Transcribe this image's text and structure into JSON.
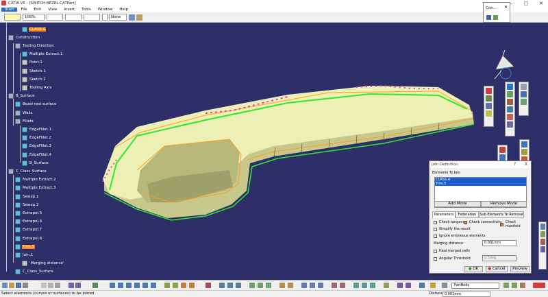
{
  "window": {
    "title": "CATIA V5 - [SWITCH BEZEL.CATPart]"
  },
  "menu": [
    "Start",
    "File",
    "Edit",
    "View",
    "Insert",
    "Tools",
    "Window",
    "Help"
  ],
  "toolbar": {
    "zoom": "100%",
    "layer": "None"
  },
  "con_dialog": {
    "title": "Con..."
  },
  "tree": [
    {
      "label": "CLASS A",
      "indent": 2,
      "selected": true,
      "icon": "surf"
    },
    {
      "label": "Construction",
      "indent": 0,
      "icon": "gear"
    },
    {
      "label": "Tooling Direction",
      "indent": 1,
      "icon": "gear"
    },
    {
      "label": "Multiple Extract.1",
      "indent": 2,
      "icon": "surf"
    },
    {
      "label": "Point.1",
      "indent": 2,
      "icon": "plain"
    },
    {
      "label": "Sketch.1",
      "indent": 2,
      "icon": "plain"
    },
    {
      "label": "Sketch.2",
      "indent": 2,
      "icon": "plain"
    },
    {
      "label": "Tooling Axis",
      "indent": 2,
      "icon": "plain"
    },
    {
      "label": "B_Surface",
      "indent": 0,
      "icon": "gear"
    },
    {
      "label": "Bezel rest surface",
      "indent": 1,
      "icon": "surf"
    },
    {
      "label": "Walls",
      "indent": 1,
      "icon": "gear"
    },
    {
      "label": "Fillets",
      "indent": 1,
      "icon": "gear"
    },
    {
      "label": "EdgeFillet.1",
      "indent": 2,
      "icon": "surf"
    },
    {
      "label": "EdgeFillet.2",
      "indent": 2,
      "icon": "surf"
    },
    {
      "label": "EdgeFillet.3",
      "indent": 2,
      "icon": "surf"
    },
    {
      "label": "EdgeFillet.4",
      "indent": 2,
      "icon": "surf"
    },
    {
      "label": "B_Surface",
      "indent": 2,
      "icon": "surf"
    },
    {
      "label": "C_Class_Surface",
      "indent": 0,
      "icon": "gear"
    },
    {
      "label": "Multiple Extract.2",
      "indent": 1,
      "icon": "surf"
    },
    {
      "label": "Multiple Extract.3",
      "indent": 1,
      "icon": "surf"
    },
    {
      "label": "Sweep.1",
      "indent": 1,
      "icon": "surf"
    },
    {
      "label": "Sweep.2",
      "indent": 1,
      "icon": "surf"
    },
    {
      "label": "Extrapol.5",
      "indent": 1,
      "icon": "surf"
    },
    {
      "label": "Extrapol.6",
      "indent": 1,
      "icon": "surf"
    },
    {
      "label": "Extrapol.7",
      "indent": 1,
      "icon": "surf"
    },
    {
      "label": "Extrapol.8",
      "indent": 1,
      "icon": "surf"
    },
    {
      "label": "Trim.5",
      "indent": 1,
      "selected": true,
      "icon": "surf"
    },
    {
      "label": "Join.1",
      "indent": 1,
      "icon": "surf"
    },
    {
      "label": "'Merging distance'",
      "indent": 2,
      "icon": "plain"
    },
    {
      "label": "C_Class_Surface",
      "indent": 1,
      "icon": "surf"
    }
  ],
  "join_dialog": {
    "title": "Join Definition",
    "help": "?",
    "close": "X",
    "elements_label": "Elements To Join",
    "elements": [
      "CLASS A",
      "Trim.5"
    ],
    "add_mode": "Add Mode",
    "remove_mode": "Remove Mode",
    "tabs": [
      "Parameters",
      "Federation",
      "Sub-Elements To Remove"
    ],
    "check_tangency": "Check tangency",
    "check_connectivity": "Check connectivity",
    "check_manifold": "Check manifold",
    "simplify": "Simplify the result",
    "ignore": "Ignore erroneous elements",
    "merging_label": "Merging distance",
    "merging_value": "0.001mm",
    "heal": "Heal merged cells",
    "angular_label": "Angular Threshold",
    "angular_value": "0.5deg",
    "ok": "OK",
    "cancel": "Cancel",
    "preview": "Preview"
  },
  "bottom": {
    "body": "PartBody"
  },
  "status": {
    "message": "Select elements (curves or surfaces) to be joined",
    "distance_label": "Distance",
    "distance_value": "0.001mm"
  },
  "colors": {
    "canvas": "#2e2f68",
    "part_face": "#ecf0b4",
    "edge_green": "#2ee82e",
    "edge_orange": "#ff9d1a",
    "selection": "#ff7f17"
  }
}
